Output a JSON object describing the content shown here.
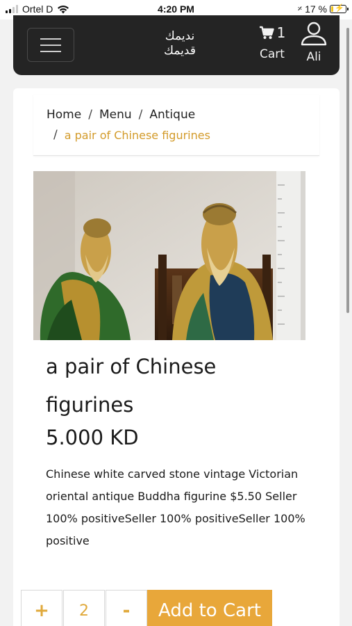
{
  "status_bar": {
    "carrier": "Ortel D",
    "time": "4:20 PM",
    "battery": "17 %",
    "battery_level": 0.17
  },
  "header": {
    "logo_line1": "نديمك",
    "logo_line2": "قديمك",
    "cart_count": "1",
    "cart_label": "Cart",
    "user_label": "Ali",
    "icons": [
      "menu-icon",
      "cart-icon",
      "user-icon"
    ]
  },
  "breadcrumb": {
    "home": "Home",
    "sep": "/",
    "menu": "Menu",
    "antique": "Antique",
    "current": "a pair of Chinese figurines"
  },
  "product": {
    "title": "a pair of Chinese figurines",
    "price": "5.000 KD",
    "description": "Chinese white carved stone vintage Victorian oriental antique Buddha figurine $5.50 Seller 100% positiveSeller 100% positiveSeller 100% positive"
  },
  "purchase": {
    "plus": "+",
    "quantity": "2",
    "minus": "-",
    "add_to_cart": "Add to Cart"
  },
  "colors": {
    "accent": "#e8a73a",
    "breadcrumb_current": "#d39b2a",
    "header_bg": "#242424"
  }
}
